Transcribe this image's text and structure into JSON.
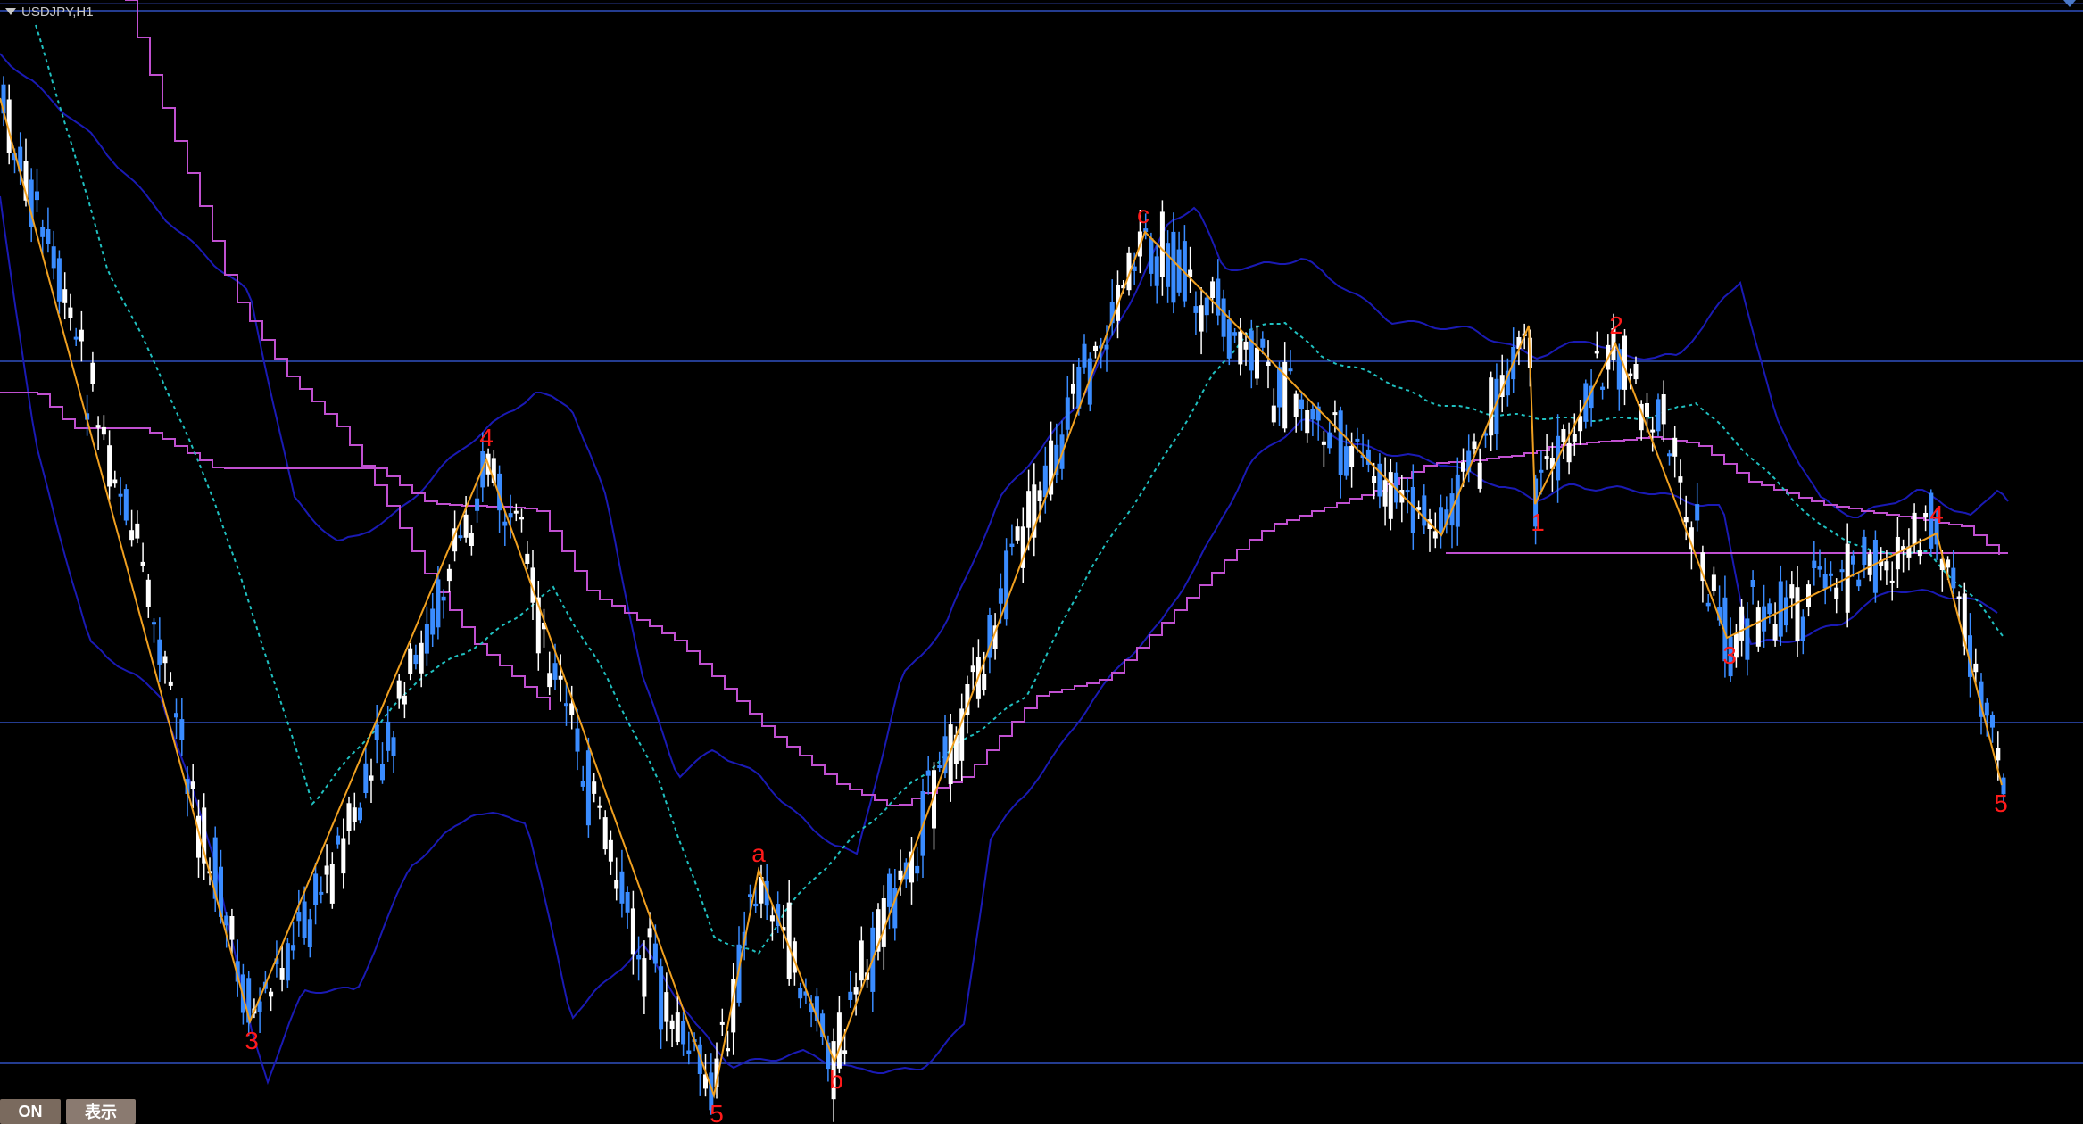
{
  "window": {
    "title": "USDJPY,H1"
  },
  "buttons": {
    "on_label": "ON",
    "show_label": "表示"
  },
  "colors": {
    "background": "#000000",
    "bull_candle": "#3a8cff",
    "bear_candle": "#ffffff",
    "bollinger": "#1a1ab4",
    "stepped_line": "#c050d0",
    "moving_average": "#20c0c0",
    "zigzag": "#f0a020",
    "wave_label": "#ff1a1a",
    "horizontal_line": "#3050c0"
  },
  "wave_labels": [
    "3",
    "4",
    "5",
    "a",
    "b",
    "c",
    "1",
    "2",
    "3",
    "4",
    "5"
  ]
}
